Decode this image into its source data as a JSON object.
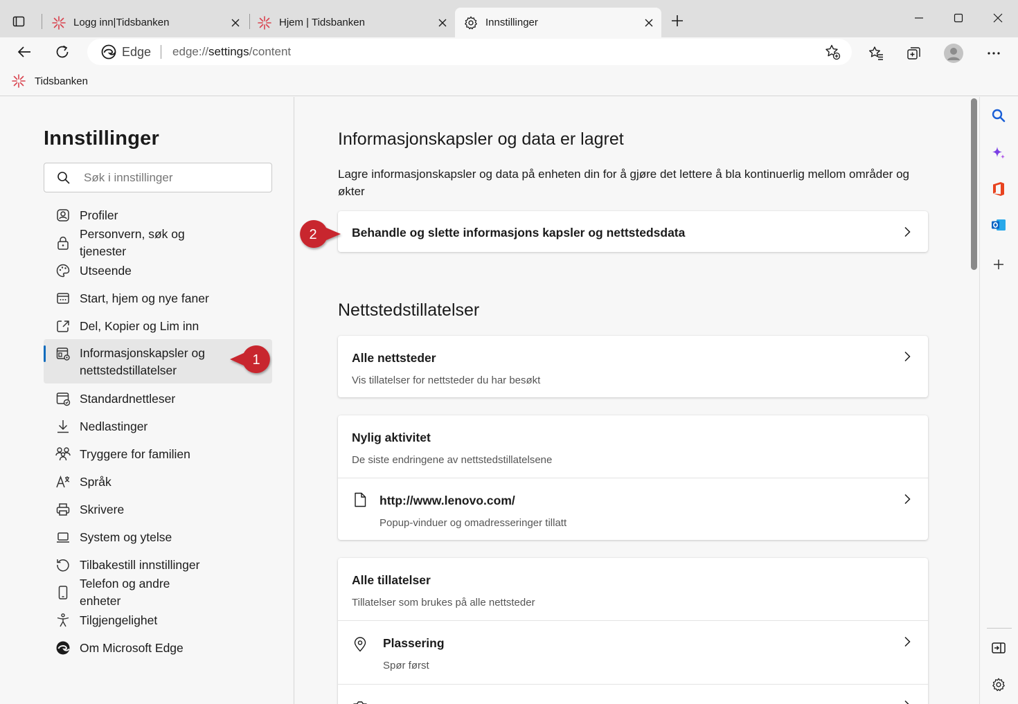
{
  "tabs": [
    {
      "title": "Logg inn|Tidsbanken",
      "active": false
    },
    {
      "title": "Hjem | Tidsbanken",
      "active": false
    },
    {
      "title": "Innstillinger",
      "active": true
    }
  ],
  "address": {
    "site_name": "Edge",
    "url_scheme": "edge://",
    "url_host": "settings",
    "url_path": "/content"
  },
  "favorites": [
    {
      "label": "Tidsbanken"
    }
  ],
  "sidebar": {
    "title": "Innstillinger",
    "search_placeholder": "Søk i innstillinger",
    "items": [
      {
        "label": "Profiler",
        "icon": "profile-icon"
      },
      {
        "label": "Personvern, søk og tjenester",
        "icon": "lock-icon"
      },
      {
        "label": "Utseende",
        "icon": "palette-icon"
      },
      {
        "label": "Start, hjem og nye faner",
        "icon": "start-page-icon"
      },
      {
        "label": "Del, Kopier og Lim inn",
        "icon": "share-icon"
      },
      {
        "label": "Informasjonskapsler og nettstedstillatelser",
        "icon": "cookies-site-icon",
        "active": true
      },
      {
        "label": "Standardnettleser",
        "icon": "default-browser-icon"
      },
      {
        "label": "Nedlastinger",
        "icon": "download-icon"
      },
      {
        "label": "Tryggere for familien",
        "icon": "family-icon"
      },
      {
        "label": "Språk",
        "icon": "language-icon"
      },
      {
        "label": "Skrivere",
        "icon": "printer-icon"
      },
      {
        "label": "System og ytelse",
        "icon": "laptop-icon"
      },
      {
        "label": "Tilbakestill innstillinger",
        "icon": "reset-icon"
      },
      {
        "label": "Telefon og andre enheter",
        "icon": "phone-icon"
      },
      {
        "label": "Tilgjengelighet",
        "icon": "accessibility-icon"
      },
      {
        "label": "Om Microsoft Edge",
        "icon": "edge-logo-icon"
      }
    ]
  },
  "main": {
    "cookies_section": {
      "title": "Informasjonskapsler og data er lagret",
      "description": "Lagre informasjonskapsler og data på enheten din for å gjøre det lettere å bla kontinuerlig mellom områder og økter",
      "manage_row": "Behandle og slette informasjons kapsler og nettstedsdata"
    },
    "permissions_section": {
      "title": "Nettstedstillatelser",
      "all_sites": {
        "title": "Alle nettsteder",
        "subtitle": "Vis tillatelser for nettsteder du har besøkt"
      },
      "recent": {
        "title": "Nylig aktivitet",
        "subtitle": "De siste endringene av nettstedstillatelsene",
        "entry_url": "http://www.lenovo.com/",
        "entry_sub": "Popup-vinduer og omadresseringer tillatt"
      },
      "all_permissions": {
        "title": "Alle tillatelser",
        "subtitle": "Tillatelser som brukes på alle nettsteder",
        "location_title": "Plassering",
        "location_sub": "Spør først"
      }
    }
  },
  "callouts": {
    "one": "1",
    "two": "2"
  },
  "colors": {
    "callout_red": "#c8272e",
    "accent_blue": "#0f6cbd"
  }
}
